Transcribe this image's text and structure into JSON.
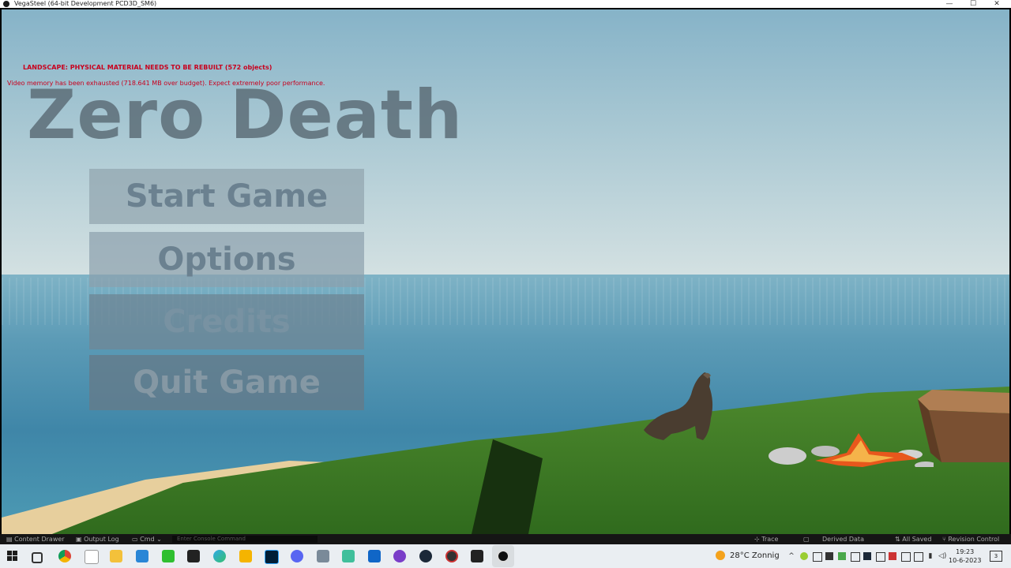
{
  "window": {
    "title": "VegaSteel (64-bit Development PCD3D_SM6)",
    "controls": [
      "—",
      "☐",
      "✕"
    ]
  },
  "debug": {
    "line1": "LANDSCAPE: PHYSICAL MATERIAL NEEDS TO BE REBUILT (572 objects)",
    "line2": "Video memory has been exhausted (718.641 MB over budget). Expect extremely poor performance.",
    "color": "#c8001e"
  },
  "menu": {
    "title": "Zero Death",
    "buttons": [
      "Start Game",
      "Options",
      "Credits",
      "Quit Game"
    ]
  },
  "editor_bar": {
    "content_drawer": "Content Drawer",
    "output_log": "Output Log",
    "cmd": "Cmd",
    "console_placeholder": "Enter Console Command",
    "trace": "Trace",
    "derived_data": "Derived Data",
    "all_saved": "All Saved",
    "revision_control": "Revision Control"
  },
  "taskbar": {
    "icons": [
      "windows-start",
      "task-view",
      "chrome",
      "files",
      "file-explorer",
      "xbox",
      "epic-games",
      "edge",
      "rockstar",
      "mail",
      "photoshop",
      "discord",
      "calculator",
      "tpm",
      "outlook",
      "github",
      "steam",
      "app",
      "epic-games",
      "unreal-engine"
    ],
    "weather_temp": "28°C",
    "weather_text": "Zonnig",
    "time": "19:23",
    "date": "10-6-2023",
    "notifications": "3"
  }
}
